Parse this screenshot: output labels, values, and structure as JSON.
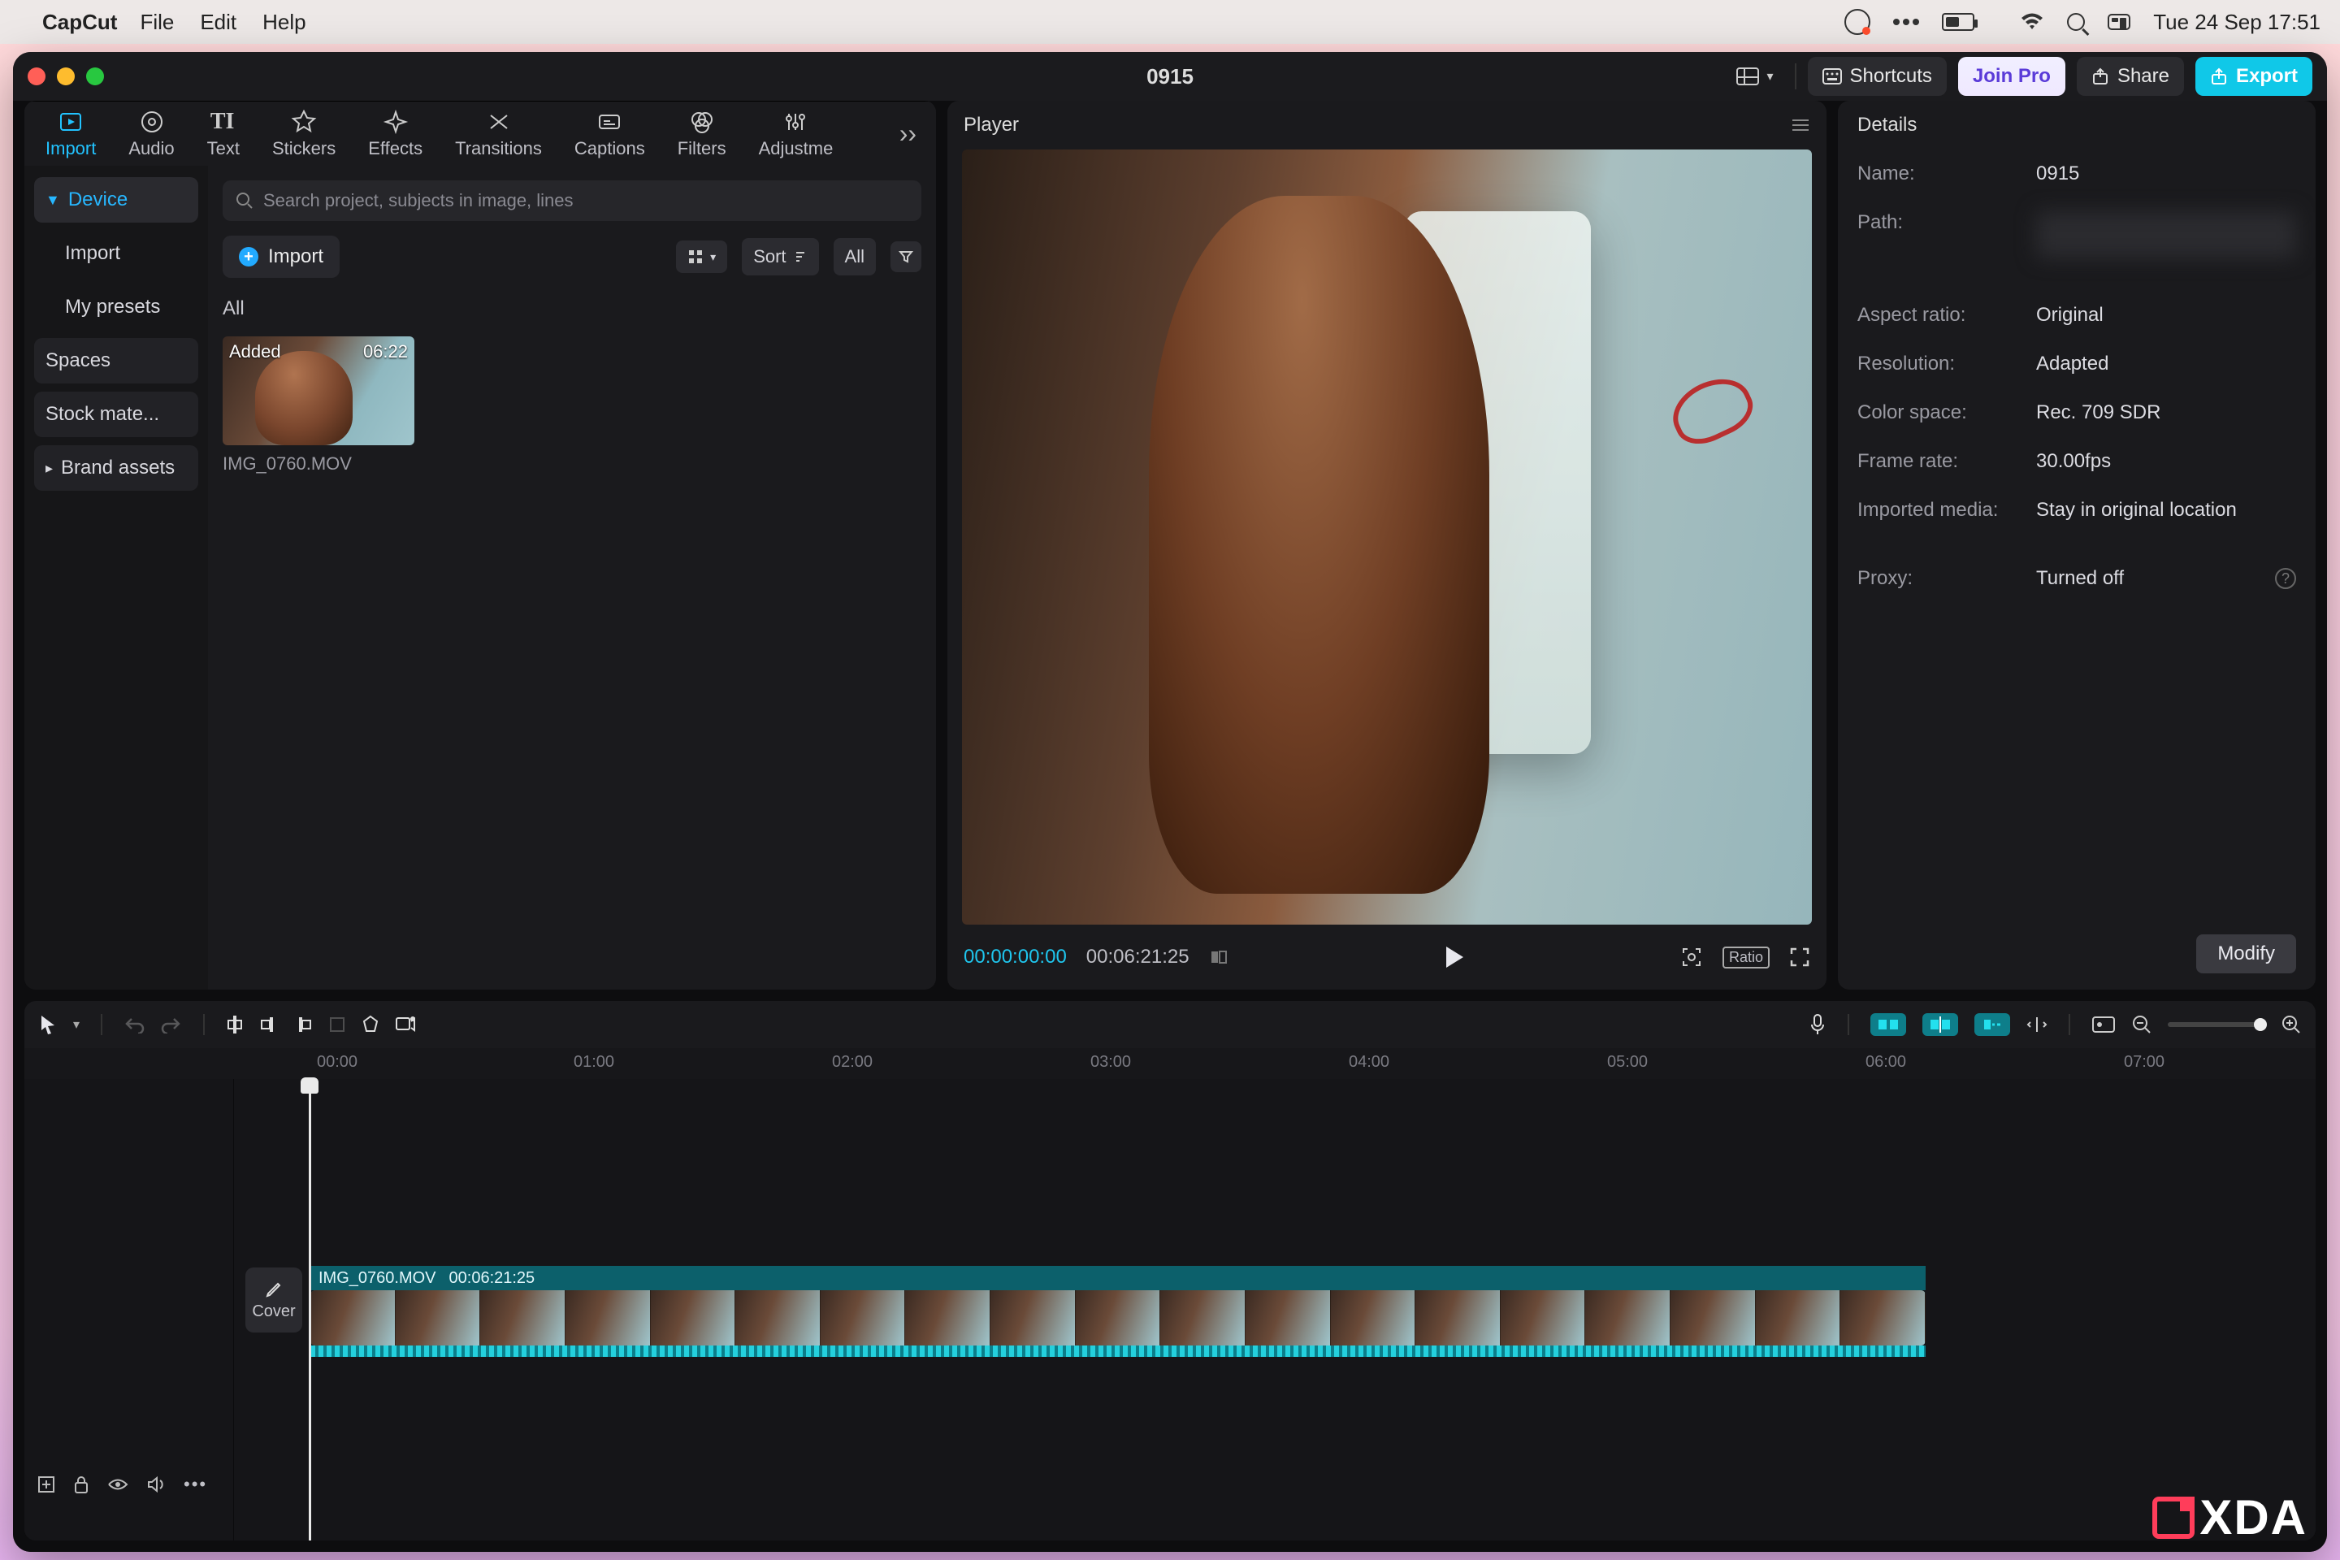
{
  "os_menubar": {
    "app_name": "CapCut",
    "items": [
      "File",
      "Edit",
      "Help"
    ],
    "clock": "Tue 24 Sep  17:51"
  },
  "window": {
    "title": "0915",
    "actions": {
      "shortcuts": "Shortcuts",
      "join_pro": "Join Pro",
      "share": "Share",
      "export": "Export"
    }
  },
  "toolbar_tabs": [
    "Import",
    "Audio",
    "Text",
    "Stickers",
    "Effects",
    "Transitions",
    "Captions",
    "Filters",
    "Adjustme"
  ],
  "toolbar_active": "Import",
  "media_sidebar": {
    "items": [
      "Device",
      "Import",
      "My presets",
      "Spaces",
      "Stock mate...",
      "Brand assets"
    ],
    "selected": "Device"
  },
  "media_area": {
    "search_placeholder": "Search project, subjects in image, lines",
    "import_btn": "Import",
    "sort_label": "Sort",
    "all_chip": "All",
    "section_label": "All",
    "clips": [
      {
        "filename": "IMG_0760.MOV",
        "badge_left": "Added",
        "badge_right": "06:22"
      }
    ]
  },
  "player": {
    "title": "Player",
    "current_time": "00:00:00:00",
    "total_time": "00:06:21:25",
    "ratio_label": "Ratio"
  },
  "details": {
    "title": "Details",
    "rows": {
      "name_k": "Name:",
      "name_v": "0915",
      "path_k": "Path:",
      "aspect_k": "Aspect ratio:",
      "aspect_v": "Original",
      "res_k": "Resolution:",
      "res_v": "Adapted",
      "cspace_k": "Color space:",
      "cspace_v": "Rec. 709 SDR",
      "fps_k": "Frame rate:",
      "fps_v": "30.00fps",
      "imported_k": "Imported media:",
      "imported_v": "Stay in original location",
      "proxy_k": "Proxy:",
      "proxy_v": "Turned off"
    },
    "modify_btn": "Modify"
  },
  "timeline": {
    "ruler": [
      "00:00",
      "01:00",
      "02:00",
      "03:00",
      "04:00",
      "05:00",
      "06:00",
      "07:00"
    ],
    "clip_name": "IMG_0760.MOV",
    "clip_dur": "00:06:21:25",
    "cover_label": "Cover"
  },
  "watermark": "XDA"
}
